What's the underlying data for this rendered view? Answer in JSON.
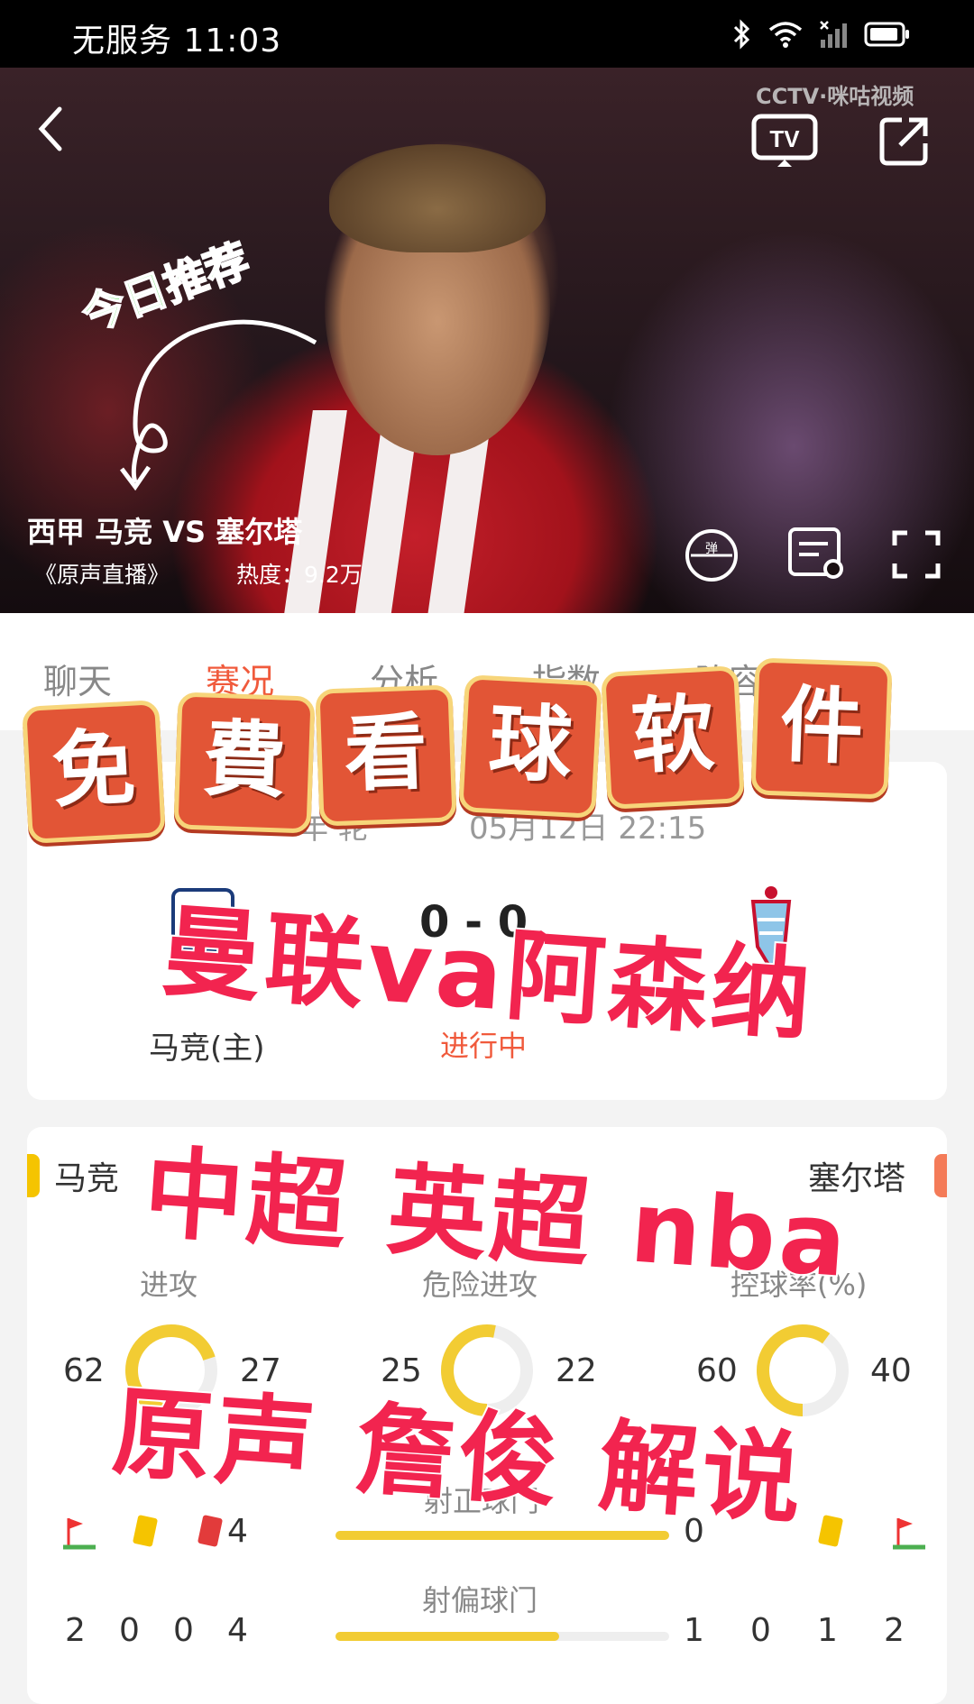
{
  "status_bar": {
    "carrier": "无服务",
    "time": "11:03"
  },
  "video": {
    "title": "西甲 马竞 VS 塞尔塔",
    "subtitle": "《原声直播》",
    "heat": "热度：9.2万",
    "overlay_tag": "今日推荐",
    "watermark": "CCTV·咪咕视频"
  },
  "tabs": [
    {
      "label": "聊天"
    },
    {
      "label": "赛况",
      "active": true
    },
    {
      "label": "分析"
    },
    {
      "label": "指数"
    },
    {
      "label": "阵容"
    }
  ],
  "match": {
    "time_partial": "05月12日 22:15",
    "round_partial": "年",
    "round_partial2": "轮",
    "score_partial": "0 - 0",
    "home": "马竞(主)",
    "status_partial": "进行中"
  },
  "stats": {
    "home": "马竞",
    "away": "塞尔塔",
    "donuts": [
      {
        "label": "进攻",
        "home": "62",
        "away": "27",
        "home_share": 0.7
      },
      {
        "label": "危险进攻",
        "home": "25",
        "away": "22",
        "home_share": 0.53
      },
      {
        "label": "控球率(%)",
        "home": "60",
        "away": "40",
        "home_share": 0.6
      }
    ],
    "row1": {
      "home_vals": [
        "",
        "",
        "",
        "4"
      ],
      "away_vals": [
        "0",
        "",
        "",
        ""
      ],
      "label": "射正球门",
      "home_frac": 1.0
    },
    "row2": {
      "home_vals": [
        "2",
        "0",
        "0",
        "4"
      ],
      "away_vals": [
        "1",
        "0",
        "1",
        "2"
      ],
      "label": "射偏球门",
      "home_frac": 0.67
    }
  },
  "promo": {
    "badges": [
      "免",
      "費",
      "看",
      "球",
      "软",
      "件"
    ],
    "line1": "曼联va阿森纳",
    "line2": "中超 英超 nba",
    "line3": "原声 詹俊 解说"
  },
  "colors": {
    "accent": "#f05a3c",
    "promo_red": "#f2244f",
    "badge": "#e25536",
    "bar": "#f2cc33"
  }
}
